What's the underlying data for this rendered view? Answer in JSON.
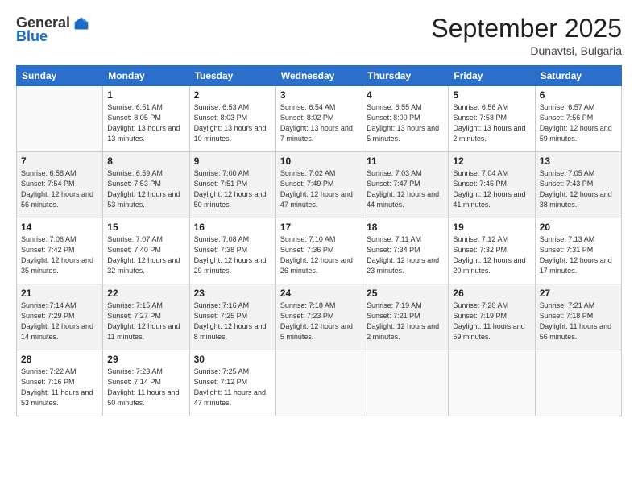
{
  "logo": {
    "general": "General",
    "blue": "Blue"
  },
  "header": {
    "month": "September 2025",
    "location": "Dunavtsi, Bulgaria"
  },
  "days_of_week": [
    "Sunday",
    "Monday",
    "Tuesday",
    "Wednesday",
    "Thursday",
    "Friday",
    "Saturday"
  ],
  "weeks": [
    [
      {
        "day": "",
        "info": ""
      },
      {
        "day": "1",
        "info": "Sunrise: 6:51 AM\nSunset: 8:05 PM\nDaylight: 13 hours\nand 13 minutes."
      },
      {
        "day": "2",
        "info": "Sunrise: 6:53 AM\nSunset: 8:03 PM\nDaylight: 13 hours\nand 10 minutes."
      },
      {
        "day": "3",
        "info": "Sunrise: 6:54 AM\nSunset: 8:02 PM\nDaylight: 13 hours\nand 7 minutes."
      },
      {
        "day": "4",
        "info": "Sunrise: 6:55 AM\nSunset: 8:00 PM\nDaylight: 13 hours\nand 5 minutes."
      },
      {
        "day": "5",
        "info": "Sunrise: 6:56 AM\nSunset: 7:58 PM\nDaylight: 13 hours\nand 2 minutes."
      },
      {
        "day": "6",
        "info": "Sunrise: 6:57 AM\nSunset: 7:56 PM\nDaylight: 12 hours\nand 59 minutes."
      }
    ],
    [
      {
        "day": "7",
        "info": "Sunrise: 6:58 AM\nSunset: 7:54 PM\nDaylight: 12 hours\nand 56 minutes."
      },
      {
        "day": "8",
        "info": "Sunrise: 6:59 AM\nSunset: 7:53 PM\nDaylight: 12 hours\nand 53 minutes."
      },
      {
        "day": "9",
        "info": "Sunrise: 7:00 AM\nSunset: 7:51 PM\nDaylight: 12 hours\nand 50 minutes."
      },
      {
        "day": "10",
        "info": "Sunrise: 7:02 AM\nSunset: 7:49 PM\nDaylight: 12 hours\nand 47 minutes."
      },
      {
        "day": "11",
        "info": "Sunrise: 7:03 AM\nSunset: 7:47 PM\nDaylight: 12 hours\nand 44 minutes."
      },
      {
        "day": "12",
        "info": "Sunrise: 7:04 AM\nSunset: 7:45 PM\nDaylight: 12 hours\nand 41 minutes."
      },
      {
        "day": "13",
        "info": "Sunrise: 7:05 AM\nSunset: 7:43 PM\nDaylight: 12 hours\nand 38 minutes."
      }
    ],
    [
      {
        "day": "14",
        "info": "Sunrise: 7:06 AM\nSunset: 7:42 PM\nDaylight: 12 hours\nand 35 minutes."
      },
      {
        "day": "15",
        "info": "Sunrise: 7:07 AM\nSunset: 7:40 PM\nDaylight: 12 hours\nand 32 minutes."
      },
      {
        "day": "16",
        "info": "Sunrise: 7:08 AM\nSunset: 7:38 PM\nDaylight: 12 hours\nand 29 minutes."
      },
      {
        "day": "17",
        "info": "Sunrise: 7:10 AM\nSunset: 7:36 PM\nDaylight: 12 hours\nand 26 minutes."
      },
      {
        "day": "18",
        "info": "Sunrise: 7:11 AM\nSunset: 7:34 PM\nDaylight: 12 hours\nand 23 minutes."
      },
      {
        "day": "19",
        "info": "Sunrise: 7:12 AM\nSunset: 7:32 PM\nDaylight: 12 hours\nand 20 minutes."
      },
      {
        "day": "20",
        "info": "Sunrise: 7:13 AM\nSunset: 7:31 PM\nDaylight: 12 hours\nand 17 minutes."
      }
    ],
    [
      {
        "day": "21",
        "info": "Sunrise: 7:14 AM\nSunset: 7:29 PM\nDaylight: 12 hours\nand 14 minutes."
      },
      {
        "day": "22",
        "info": "Sunrise: 7:15 AM\nSunset: 7:27 PM\nDaylight: 12 hours\nand 11 minutes."
      },
      {
        "day": "23",
        "info": "Sunrise: 7:16 AM\nSunset: 7:25 PM\nDaylight: 12 hours\nand 8 minutes."
      },
      {
        "day": "24",
        "info": "Sunrise: 7:18 AM\nSunset: 7:23 PM\nDaylight: 12 hours\nand 5 minutes."
      },
      {
        "day": "25",
        "info": "Sunrise: 7:19 AM\nSunset: 7:21 PM\nDaylight: 12 hours\nand 2 minutes."
      },
      {
        "day": "26",
        "info": "Sunrise: 7:20 AM\nSunset: 7:19 PM\nDaylight: 11 hours\nand 59 minutes."
      },
      {
        "day": "27",
        "info": "Sunrise: 7:21 AM\nSunset: 7:18 PM\nDaylight: 11 hours\nand 56 minutes."
      }
    ],
    [
      {
        "day": "28",
        "info": "Sunrise: 7:22 AM\nSunset: 7:16 PM\nDaylight: 11 hours\nand 53 minutes."
      },
      {
        "day": "29",
        "info": "Sunrise: 7:23 AM\nSunset: 7:14 PM\nDaylight: 11 hours\nand 50 minutes."
      },
      {
        "day": "30",
        "info": "Sunrise: 7:25 AM\nSunset: 7:12 PM\nDaylight: 11 hours\nand 47 minutes."
      },
      {
        "day": "",
        "info": ""
      },
      {
        "day": "",
        "info": ""
      },
      {
        "day": "",
        "info": ""
      },
      {
        "day": "",
        "info": ""
      }
    ]
  ]
}
